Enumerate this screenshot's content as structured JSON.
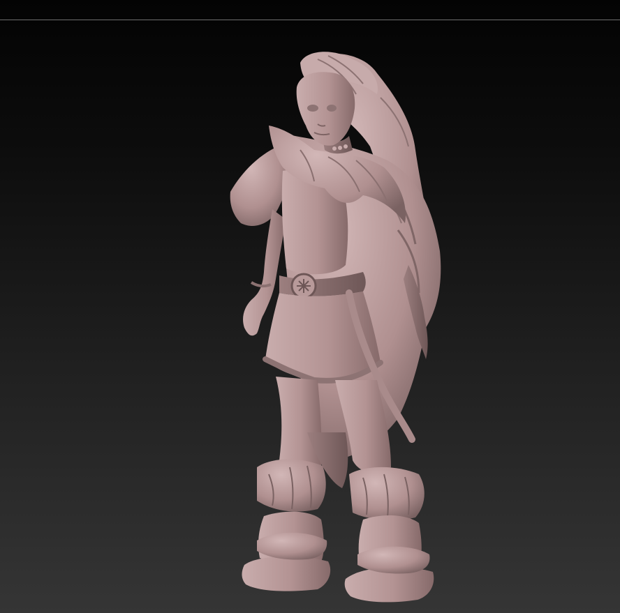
{
  "viewport": {
    "background_top": "#030303",
    "background_bottom": "#353535",
    "frame_line_color": "#6e6e6e"
  },
  "model": {
    "subject": "female-warrior-sculpt",
    "material_color": "#b89a9a",
    "shadow_color": "#6d5656",
    "highlight_color": "#d8c0c0"
  }
}
